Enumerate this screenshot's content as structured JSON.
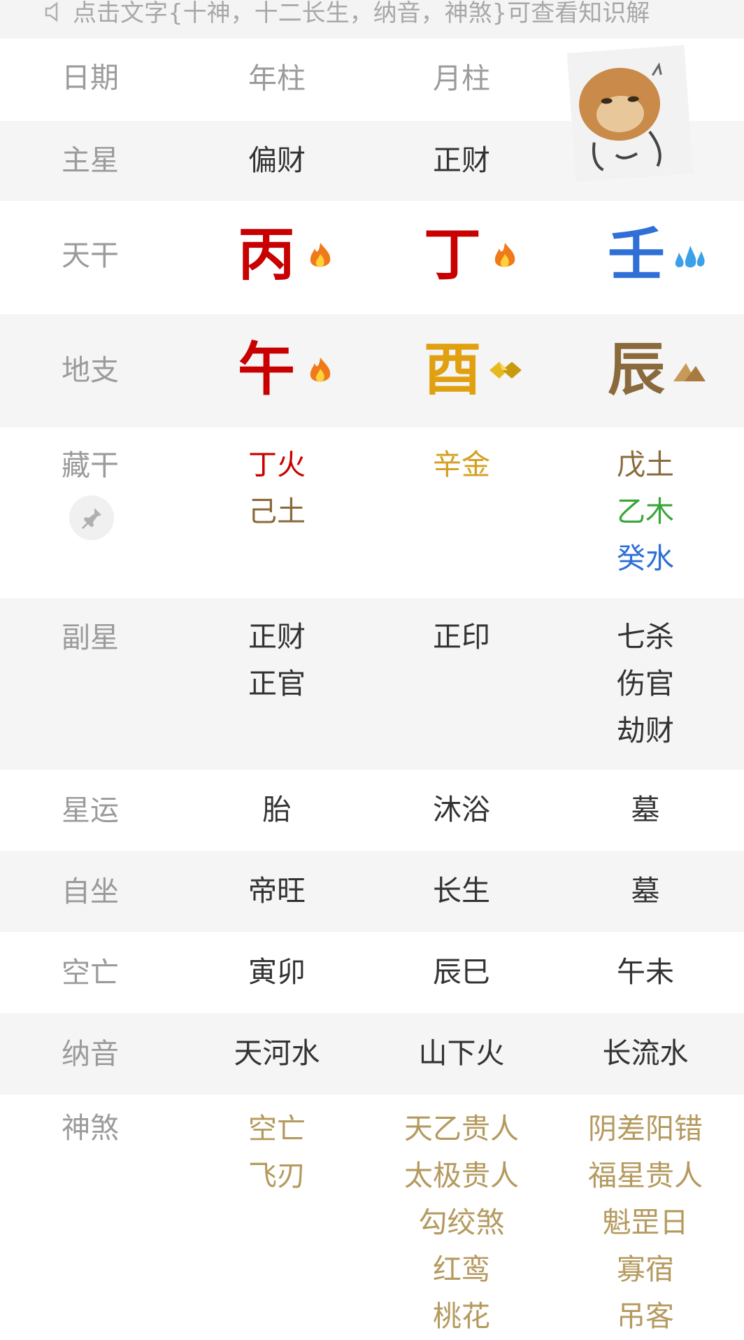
{
  "tip": {
    "text": "点击文字{十神，十二长生，纳音，神煞}可查看知识解"
  },
  "header": {
    "label": "日期",
    "cols": [
      "年柱",
      "月柱"
    ]
  },
  "rows": {
    "zhuxing": {
      "label": "主星",
      "vals": [
        "偏财",
        "正财"
      ]
    },
    "tiangan": {
      "label": "天干",
      "chars": [
        "丙",
        "丁",
        "壬"
      ]
    },
    "dizhi": {
      "label": "地支",
      "chars": [
        "午",
        "酉",
        "辰"
      ]
    },
    "canggan": {
      "label": "藏干",
      "c1": [
        "丁火",
        "己土"
      ],
      "c2": [
        "辛金"
      ],
      "c3": [
        "戊土",
        "乙木",
        "癸水"
      ]
    },
    "fuxing": {
      "label": "副星",
      "c1": [
        "正财",
        "正官"
      ],
      "c2": [
        "正印"
      ],
      "c3": [
        "七杀",
        "伤官",
        "劫财"
      ]
    },
    "xingyun": {
      "label": "星运",
      "vals": [
        "胎",
        "沐浴",
        "墓"
      ]
    },
    "zizuo": {
      "label": "自坐",
      "vals": [
        "帝旺",
        "长生",
        "墓"
      ]
    },
    "kongwang": {
      "label": "空亡",
      "vals": [
        "寅卯",
        "辰巳",
        "午未"
      ]
    },
    "nayin": {
      "label": "纳音",
      "vals": [
        "天河水",
        "山下火",
        "长流水"
      ]
    },
    "shensha": {
      "label": "神煞",
      "c1": [
        "空亡",
        "飞刃"
      ],
      "c2": [
        "天乙贵人",
        "太极贵人",
        "勾绞煞",
        "红鸾",
        "桃花"
      ],
      "c3": [
        "阴差阳错",
        "福星贵人",
        "魁罡日",
        "寡宿",
        "吊客"
      ]
    }
  },
  "colors": {
    "fire": "#c80000",
    "metal": "#e0a010",
    "earth": "#8a6a3c",
    "water": "#2f6fd6",
    "wood": "#3aa63a",
    "shensha": "#b59a5f",
    "label": "#9b9b9b"
  },
  "icons": {
    "tip": "speaker-icon",
    "fire": "flame-icon",
    "water": "water-drops-icon",
    "metal": "gold-ingot-icon",
    "earth": "mountain-icon",
    "pin": "pin-icon",
    "sticker": "cat-sticker"
  }
}
